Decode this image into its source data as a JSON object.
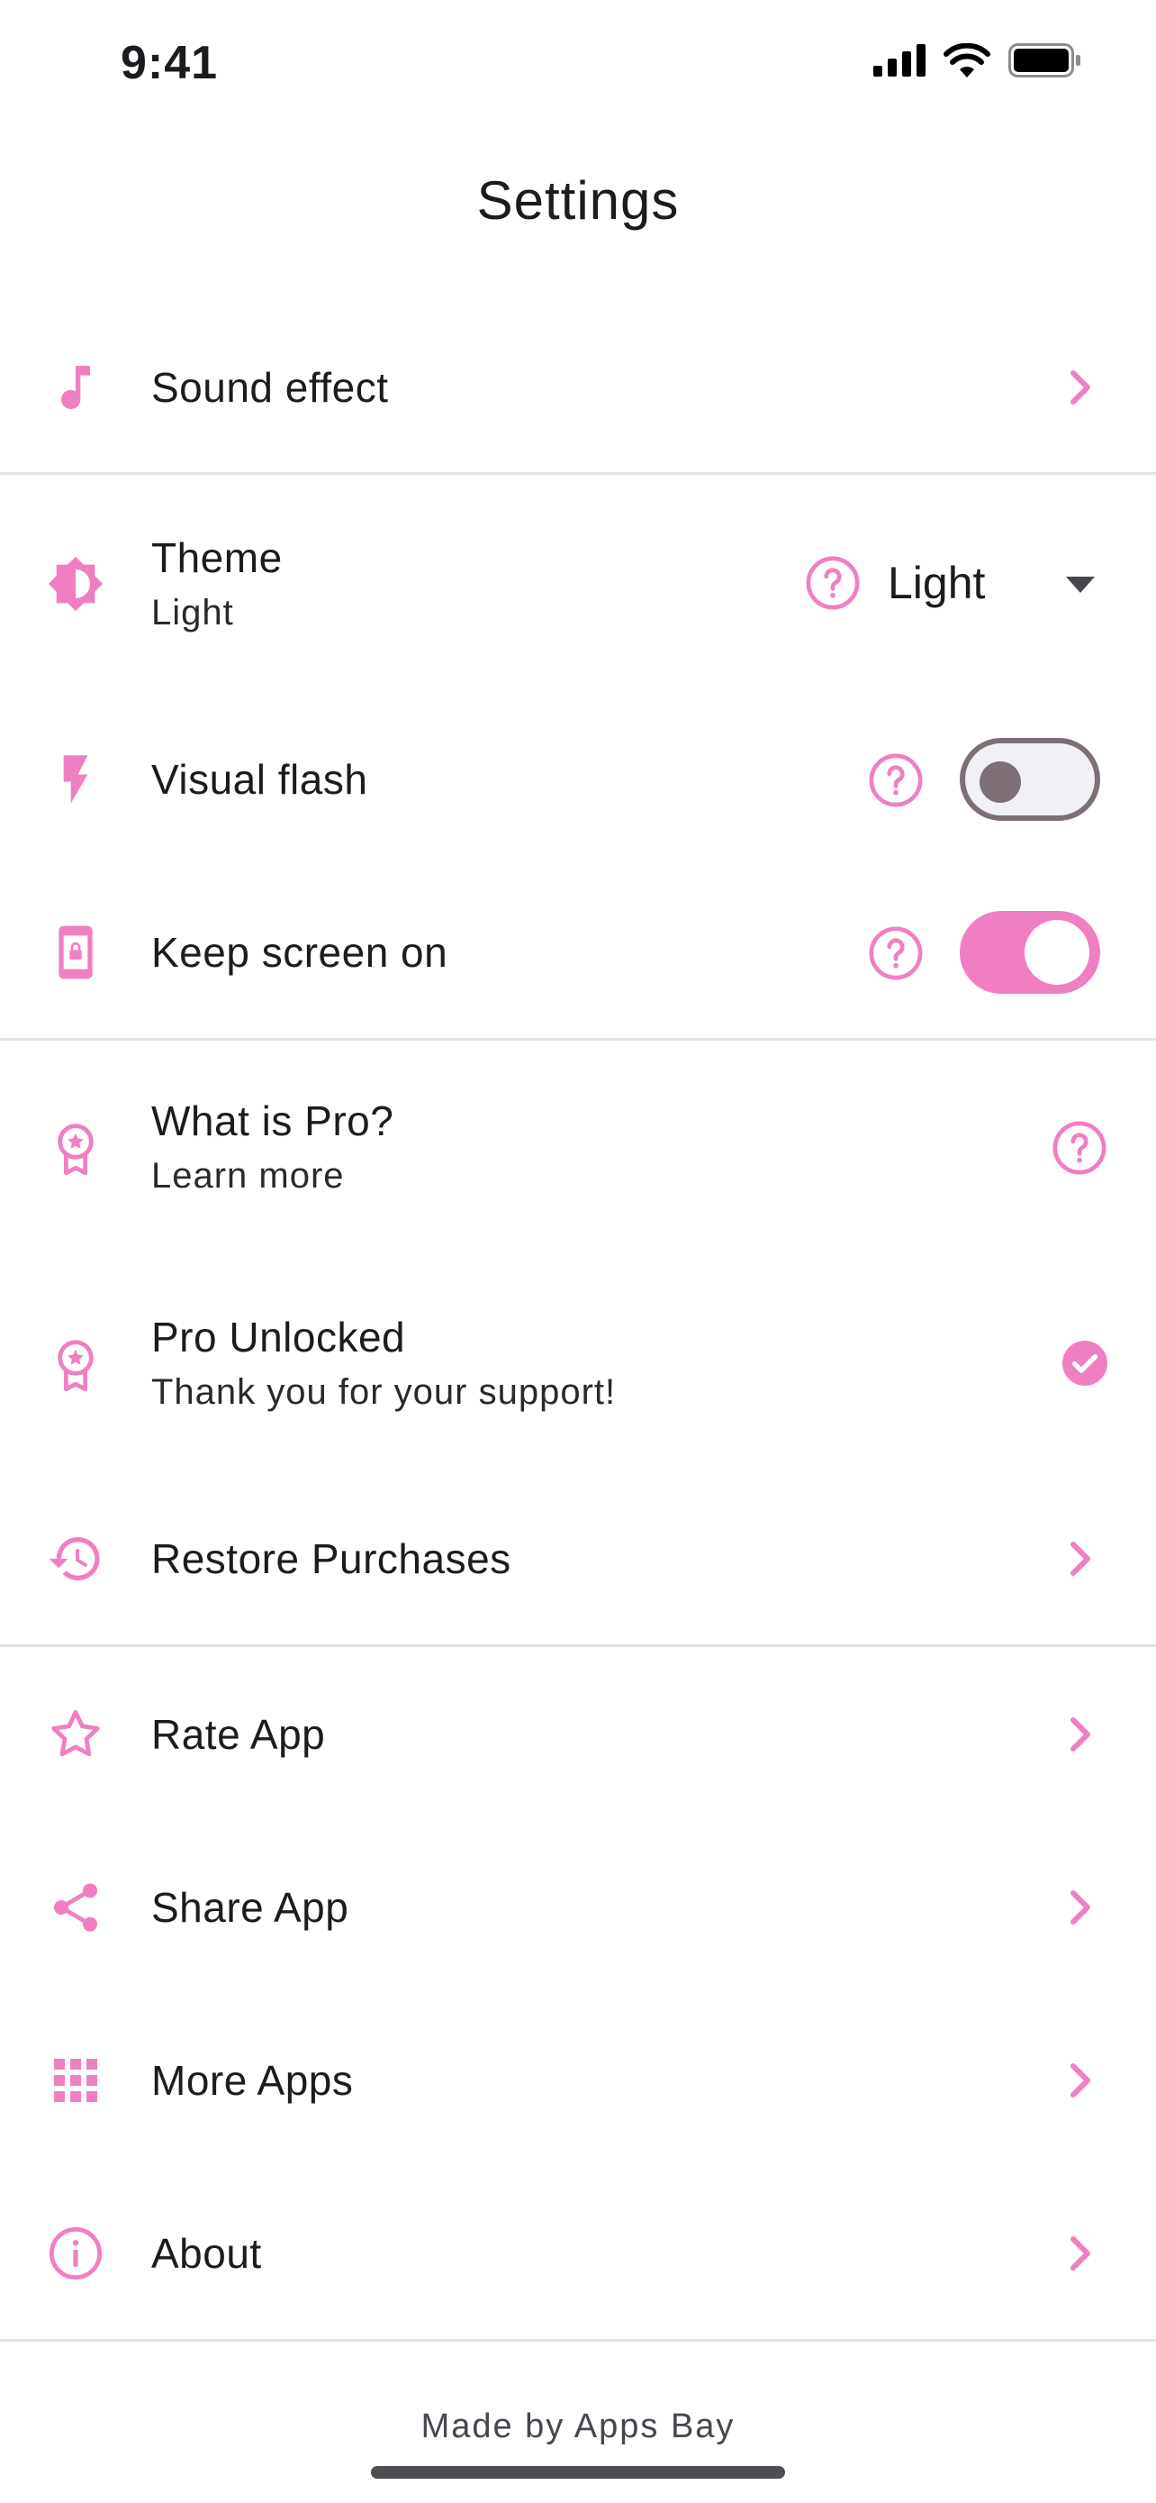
{
  "status": {
    "time": "9:41"
  },
  "header": {
    "title": "Settings"
  },
  "colors": {
    "accent": "#f07fc2",
    "divider": "#e3e3e6",
    "toggle_off": "#7c6f76"
  },
  "rows": {
    "sound": {
      "label": "Sound effect",
      "icon": "music-note-icon"
    },
    "theme": {
      "label": "Theme",
      "subtitle": "Light",
      "value": "Light",
      "icon": "theme-icon"
    },
    "visual_flash": {
      "label": "Visual flash",
      "icon": "bolt-icon",
      "enabled": false
    },
    "keep_screen": {
      "label": "Keep screen on",
      "icon": "phone-lock-icon",
      "enabled": true
    },
    "what_pro": {
      "label": "What is Pro?",
      "subtitle": "Learn more",
      "icon": "badge-icon"
    },
    "pro_unlocked": {
      "label": "Pro Unlocked",
      "subtitle": "Thank you for your support!",
      "icon": "badge-icon"
    },
    "restore": {
      "label": "Restore Purchases",
      "icon": "history-icon"
    },
    "rate": {
      "label": "Rate App",
      "icon": "star-icon"
    },
    "share": {
      "label": "Share App",
      "icon": "share-icon"
    },
    "more": {
      "label": "More Apps",
      "icon": "grid-icon"
    },
    "about": {
      "label": "About",
      "icon": "info-icon"
    }
  },
  "footer": {
    "text": "Made by Apps Bay"
  }
}
